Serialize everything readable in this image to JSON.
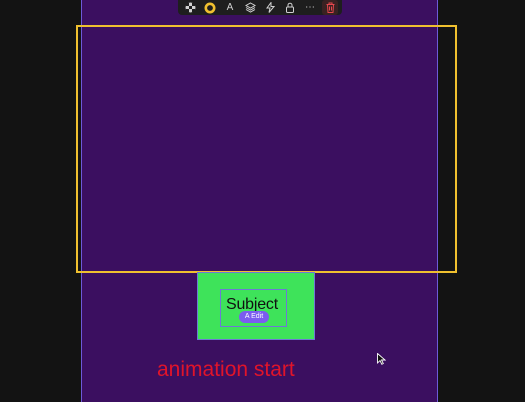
{
  "toolbar": {
    "items": [
      {
        "icon": "checkerboard-icon"
      },
      {
        "icon": "ring-icon",
        "color": "#f0c02f"
      },
      {
        "icon": "text-icon",
        "label": "A"
      },
      {
        "icon": "layers-icon"
      },
      {
        "icon": "lightning-icon"
      },
      {
        "icon": "lock-icon"
      },
      {
        "icon": "more-icon",
        "label": "⋯"
      },
      {
        "icon": "trash-icon",
        "color": "#e5484d"
      }
    ]
  },
  "canvas": {
    "background": "#131313",
    "artboard_color": "#3b0f60",
    "selection_color": "#f0c02f"
  },
  "subject": {
    "text": "Subject",
    "edit_label": "A Edit",
    "fill_color": "#3ee35a"
  },
  "annotation": {
    "text": "animation start",
    "color": "#e0142a"
  }
}
